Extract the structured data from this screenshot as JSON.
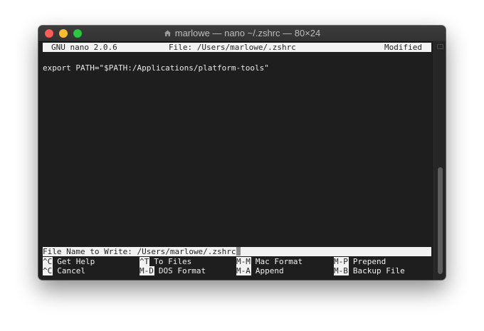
{
  "window": {
    "title": "marlowe — nano ~/.zshrc — 80×24",
    "title_icon": "home-folder-icon"
  },
  "nano": {
    "version": "GNU nano 2.0.6",
    "file_label": "File: /Users/marlowe/.zshrc",
    "status": "Modified",
    "content_lines": [
      "export PATH=\"$PATH:/Applications/platform-tools\""
    ],
    "prompt": {
      "label": "File Name to Write:",
      "value": "/Users/marlowe/.zshrc"
    },
    "shortcuts": [
      {
        "key": "^C",
        "label": "Get Help"
      },
      {
        "key": "^T",
        "label": "To Files"
      },
      {
        "key": "M-M",
        "label": "Mac Format"
      },
      {
        "key": "M-P",
        "label": "Prepend"
      },
      {
        "key": "^C",
        "label": "Cancel"
      },
      {
        "key": "M-D",
        "label": "DOS Format"
      },
      {
        "key": "M-A",
        "label": "Append"
      },
      {
        "key": "M-B",
        "label": "Backup File"
      }
    ]
  },
  "colors": {
    "terminal_background": "#1e1e1e",
    "terminal_text": "#e8e8e8",
    "inverse_bar": "#f2f2f2",
    "close_button": "#fc5f57",
    "minimize_button": "#fdbc2e",
    "zoom_button": "#28c840"
  }
}
